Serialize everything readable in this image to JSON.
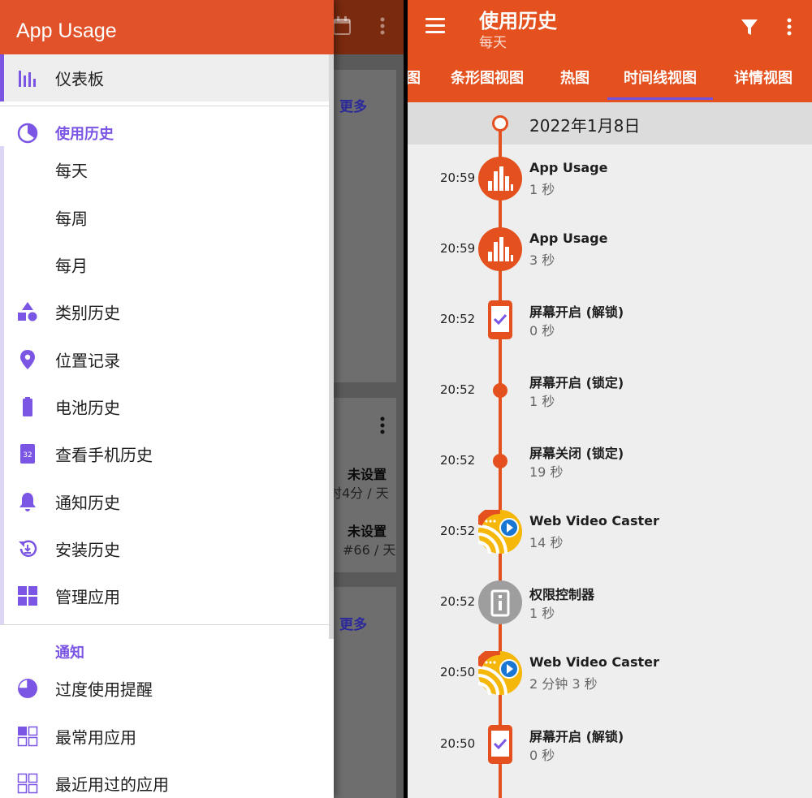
{
  "left_background": {
    "more_1": "更多",
    "more_2": "更多",
    "row1_value": "未设置",
    "row1_detail": "时4分 / 天",
    "row2_value": "未设置",
    "row2_detail": "#66 / 天"
  },
  "drawer": {
    "title": "App Usage",
    "items": [
      {
        "label": "仪表板",
        "icon": "bar-chart-icon"
      },
      {
        "label": "使用历史",
        "icon": "pie-clock-icon"
      },
      {
        "label": "每天"
      },
      {
        "label": "每周"
      },
      {
        "label": "每月"
      },
      {
        "label": "类别历史",
        "icon": "shapes-icon"
      },
      {
        "label": "位置记录",
        "icon": "location-pin-icon"
      },
      {
        "label": "电池历史",
        "icon": "battery-icon"
      },
      {
        "label": "查看手机历史",
        "icon": "calendar-32-icon"
      },
      {
        "label": "通知历史",
        "icon": "bell-icon"
      },
      {
        "label": "安装历史",
        "icon": "history-install-icon"
      },
      {
        "label": "管理应用",
        "icon": "grid-icon"
      },
      {
        "label": "通知"
      },
      {
        "label": "过度使用提醒",
        "icon": "pie-quarter-icon"
      },
      {
        "label": "最常用应用",
        "icon": "grid-mixed-icon"
      },
      {
        "label": "最近用过的应用",
        "icon": "grid-outline-icon"
      }
    ],
    "calendar_day": "32"
  },
  "appbar": {
    "title": "使用历史",
    "subtitle": "每天",
    "tabs": [
      "图",
      "条形图视图",
      "热图",
      "时间线视图",
      "详情视图"
    ],
    "active_tab": 3
  },
  "colors": {
    "accent": "#e4501e",
    "purple": "#7b55e3",
    "header": "#e2522a"
  },
  "timeline": {
    "date": "2022年1月8日",
    "entries": [
      {
        "time": "20:59",
        "name": "App Usage",
        "duration": "1 秒",
        "node": "app-usage-icon"
      },
      {
        "time": "20:59",
        "name": "App Usage",
        "duration": "3 秒",
        "node": "app-usage-icon"
      },
      {
        "time": "20:52",
        "name": "屏幕开启 (解锁)",
        "duration": "0 秒",
        "node": "phone-check-icon"
      },
      {
        "time": "20:52",
        "name": "屏幕开启 (锁定)",
        "duration": "1 秒",
        "node": "dot"
      },
      {
        "time": "20:52",
        "name": "屏幕关闭 (锁定)",
        "duration": "19 秒",
        "node": "dot"
      },
      {
        "time": "20:52",
        "name": "Web Video Caster",
        "duration": "14 秒",
        "node": "cast-icon"
      },
      {
        "time": "20:52",
        "name": "权限控制器",
        "duration": "1 秒",
        "node": "permission-icon"
      },
      {
        "time": "20:50",
        "name": "Web Video Caster",
        "duration": "2 分钟 3 秒",
        "node": "cast-icon"
      },
      {
        "time": "20:50",
        "name": "屏幕开启 (解锁)",
        "duration": "0 秒",
        "node": "phone-check-icon"
      }
    ]
  }
}
